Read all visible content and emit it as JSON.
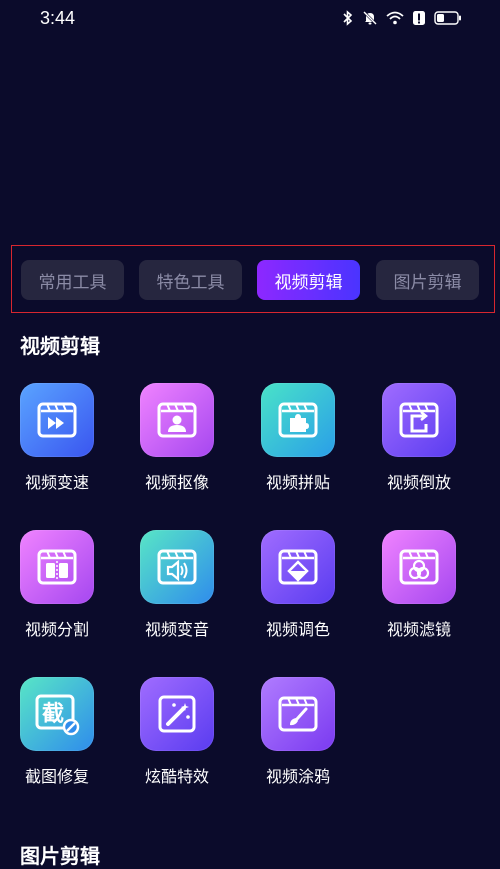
{
  "status": {
    "time": "3:44"
  },
  "tabs": [
    {
      "label": "常用工具",
      "active": false
    },
    {
      "label": "特色工具",
      "active": false
    },
    {
      "label": "视频剪辑",
      "active": true
    },
    {
      "label": "图片剪辑",
      "active": false
    }
  ],
  "sections": {
    "video": {
      "title": "视频剪辑"
    },
    "image": {
      "title": "图片剪辑"
    }
  },
  "tools": [
    {
      "label": "视频变速",
      "icon": "fast-forward-icon"
    },
    {
      "label": "视频抠像",
      "icon": "portrait-icon"
    },
    {
      "label": "视频拼贴",
      "icon": "puzzle-icon"
    },
    {
      "label": "视频倒放",
      "icon": "reverse-icon"
    },
    {
      "label": "视频分割",
      "icon": "split-icon"
    },
    {
      "label": "视频变音",
      "icon": "speaker-icon"
    },
    {
      "label": "视频调色",
      "icon": "color-icon"
    },
    {
      "label": "视频滤镜",
      "icon": "filter-icon"
    },
    {
      "label": "截图修复",
      "icon": "screenshot-repair-icon",
      "glyph": "截"
    },
    {
      "label": "炫酷特效",
      "icon": "magic-wand-icon"
    },
    {
      "label": "视频涂鸦",
      "icon": "brush-icon"
    }
  ]
}
